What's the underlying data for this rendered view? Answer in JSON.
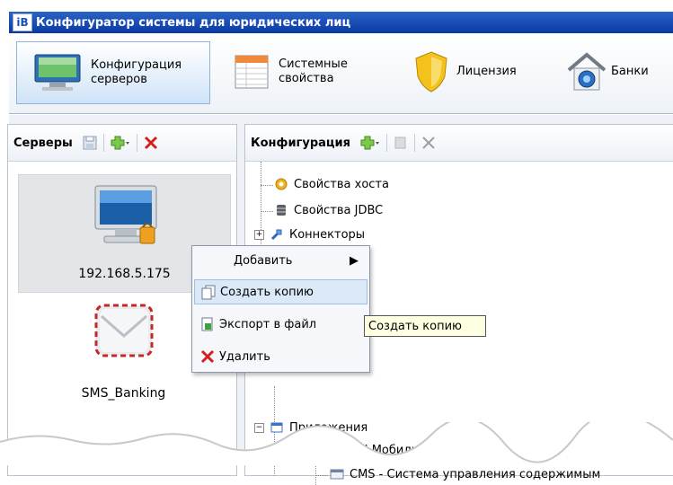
{
  "window": {
    "app_badge": "iB",
    "title": "Конфигуратор системы для юридических лиц"
  },
  "ribbon": {
    "tabs": [
      {
        "label_line1": "Конфигурация",
        "label_line2": "серверов"
      },
      {
        "label_line1": "Системные",
        "label_line2": "свойства"
      },
      {
        "label_line1": "Лицензия",
        "label_line2": ""
      },
      {
        "label_line1": "Банки",
        "label_line2": ""
      }
    ]
  },
  "servers_pane": {
    "title": "Серверы",
    "items": [
      {
        "label": "192.168.5.175"
      },
      {
        "label": "SMS_Banking"
      }
    ]
  },
  "config_pane": {
    "title": "Конфигурация",
    "tree": [
      {
        "label": "Свойства хоста"
      },
      {
        "label": "Свойства JDBC"
      },
      {
        "label": "Коннекторы"
      },
      {
        "label": "Приложения"
      },
      {
        "label": "API Мобильного Банка"
      },
      {
        "label": "CMS - Система управления содержимым"
      }
    ]
  },
  "context_menu": {
    "items": [
      {
        "label": "Добавить"
      },
      {
        "label": "Создать копию"
      },
      {
        "label": "Экспорт в файл"
      },
      {
        "label": "Удалить"
      }
    ]
  },
  "tooltip": {
    "text": "Создать копию"
  },
  "colors": {
    "title_bar": "#1b4fb8",
    "highlight": "#dbe8f7",
    "delete_red": "#d22020",
    "add_green": "#4caf2a"
  }
}
